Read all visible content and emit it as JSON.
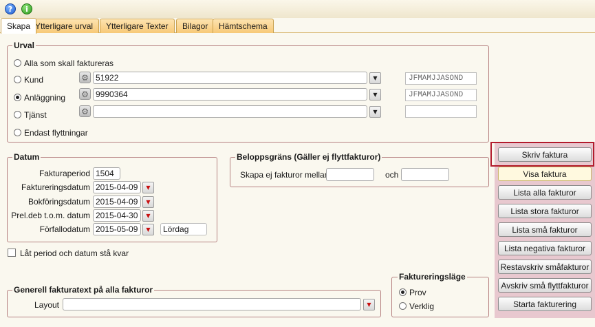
{
  "tabs": [
    {
      "label": "Skapa"
    },
    {
      "label": "Ytterligare urval"
    },
    {
      "label": "Ytterligare Texter"
    },
    {
      "label": "Bilagor"
    },
    {
      "label": "Hämtschema"
    }
  ],
  "urval": {
    "legend": "Urval",
    "options": [
      {
        "label": "Alla som skall faktureras",
        "checked": false
      },
      {
        "label": "Kund",
        "checked": false
      },
      {
        "label": "Anläggning",
        "checked": true
      },
      {
        "label": "Tjänst",
        "checked": false
      },
      {
        "label": "Endast flyttningar",
        "checked": false
      }
    ],
    "kund_value": "51922",
    "anlaggning_value": "9990364",
    "tjanst_value": "",
    "kund_months": "JFMAMJJASOND",
    "anlaggning_months": "JFMAMJJASOND",
    "tjanst_months": ""
  },
  "datum": {
    "legend": "Datum",
    "rows": [
      {
        "label": "Fakturaperiod",
        "value": "1504"
      },
      {
        "label": "Faktureringsdatum",
        "value": "2015-04-09"
      },
      {
        "label": "Bokföringsdatum",
        "value": "2015-04-09"
      },
      {
        "label": "Prel.deb t.o.m. datum",
        "value": "2015-04-30"
      },
      {
        "label": "Förfallodatum",
        "value": "2015-05-09"
      }
    ],
    "weekday": "Lördag"
  },
  "belopp": {
    "legend": "Beloppsgräns (Gäller ej flyttfakturor)",
    "label": "Skapa ej fakturor mellan",
    "och": "och",
    "from_value": "",
    "to_value": ""
  },
  "keep_checkbox": {
    "label": "Låt period och datum stå kvar",
    "checked": false
  },
  "generell": {
    "legend": "Generell fakturatext på alla fakturor",
    "layout_label": "Layout",
    "layout_value": ""
  },
  "lage": {
    "legend": "Faktureringsläge",
    "options": [
      {
        "label": "Prov",
        "checked": true
      },
      {
        "label": "Verklig",
        "checked": false
      }
    ]
  },
  "actions": [
    {
      "label": "Skriv faktura"
    },
    {
      "label": "Visa faktura"
    },
    {
      "label": "Lista alla fakturor"
    },
    {
      "label": "Lista stora fakturor"
    },
    {
      "label": "Lista små fakturor"
    },
    {
      "label": "Lista negativa fakturor"
    },
    {
      "label": "Restavskriv småfakturor"
    },
    {
      "label": "Avskriv små flyttfakturor"
    },
    {
      "label": "Starta fakturering"
    }
  ],
  "colors": {
    "accent_red": "#b31b2c",
    "tab_orange": "#f7c977",
    "panel_pink": "#e8c8cf"
  }
}
